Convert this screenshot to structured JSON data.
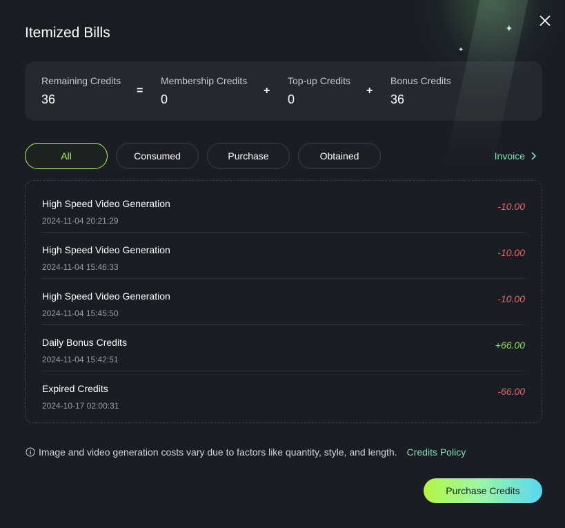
{
  "title": "Itemized Bills",
  "summary": {
    "remaining": {
      "label": "Remaining Credits",
      "value": "36"
    },
    "membership": {
      "label": "Membership Credits",
      "value": "0"
    },
    "topup": {
      "label": "Top-up Credits",
      "value": "0"
    },
    "bonus": {
      "label": "Bonus Credits",
      "value": "36"
    },
    "ops": [
      "=",
      "+",
      "+"
    ]
  },
  "tabs": [
    {
      "label": "All",
      "active": true
    },
    {
      "label": "Consumed"
    },
    {
      "label": "Purchase"
    },
    {
      "label": "Obtained"
    }
  ],
  "invoice_label": "Invoice",
  "bills": [
    {
      "title": "High Speed Video Generation",
      "date": "2024-11-04 20:21:29",
      "amount": "-10.00"
    },
    {
      "title": "High Speed Video Generation",
      "date": "2024-11-04 15:46:33",
      "amount": "-10.00"
    },
    {
      "title": "High Speed Video Generation",
      "date": "2024-11-04 15:45:50",
      "amount": "-10.00"
    },
    {
      "title": "Daily Bonus Credits",
      "date": "2024-11-04 15:42:51",
      "amount": "+66.00"
    },
    {
      "title": "Expired Credits",
      "date": "2024-10-17 02:00:31",
      "amount": "-66.00"
    }
  ],
  "note": "Image and video generation costs vary due to factors like quantity, style, and length.",
  "policy_link": "Credits Policy",
  "purchase_button": "Purchase Credits",
  "colors": {
    "accent": "#b6f25a",
    "link": "#7fe3b4",
    "negative": "#e86a6a",
    "positive": "#8fe05a"
  }
}
